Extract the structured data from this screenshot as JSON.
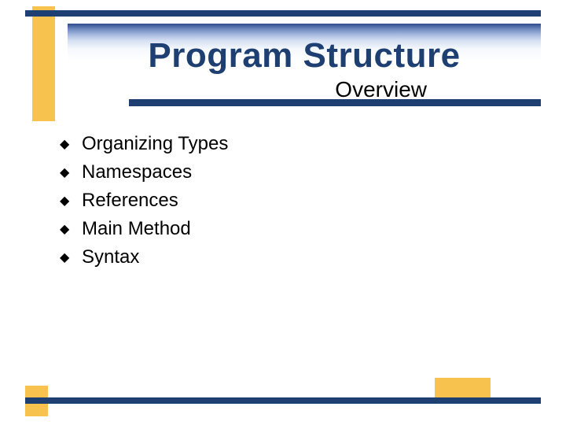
{
  "title": "Program Structure",
  "subtitle": "Overview",
  "bullets": [
    "Organizing Types",
    "Namespaces",
    "References",
    "Main Method",
    "Syntax"
  ],
  "colors": {
    "navy": "#1e3f72",
    "yellow": "#f8c24e"
  }
}
